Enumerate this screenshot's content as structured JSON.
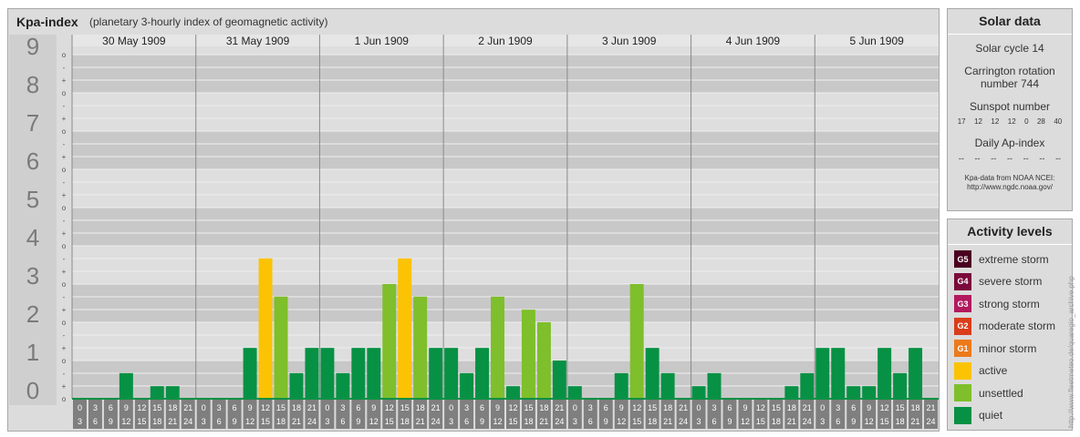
{
  "chart_data": {
    "type": "bar",
    "title": "Kpa-index",
    "subtitle": "(planetary 3-hourly index of geomagnetic activity)",
    "days": [
      "30 May 1909",
      "31 May 1909",
      "1 Jun 1909",
      "2 Jun 1909",
      "3 Jun 1909",
      "4 Jun 1909",
      "5 Jun 1909"
    ],
    "interval_labels": [
      [
        "0",
        "3"
      ],
      [
        "3",
        "6"
      ],
      [
        "6",
        "9"
      ],
      [
        "9",
        "12"
      ],
      [
        "12",
        "15"
      ],
      [
        "15",
        "18"
      ],
      [
        "18",
        "21"
      ],
      [
        "21",
        "24"
      ]
    ],
    "y_ticks": [
      "0",
      "1",
      "2",
      "3",
      "4",
      "5",
      "6",
      "7",
      "8",
      "9"
    ],
    "y_minor_ticks": [
      "o",
      "+",
      "-"
    ],
    "ylim": [
      0,
      9.33
    ],
    "values": [
      0,
      0,
      0,
      0.67,
      0,
      0.33,
      0.33,
      0,
      0,
      0,
      0,
      1.33,
      3.67,
      2.67,
      0.67,
      1.33,
      1.33,
      0.67,
      1.33,
      1.33,
      3.0,
      3.67,
      2.67,
      1.33,
      1.33,
      0.67,
      1.33,
      2.67,
      0.33,
      2.33,
      2.0,
      1.0,
      0.33,
      0,
      0,
      0.67,
      3.0,
      1.33,
      0.67,
      0,
      0.33,
      0.67,
      0,
      0,
      0,
      0,
      0.33,
      0.67,
      1.33,
      1.33,
      0.33,
      0.33,
      1.33,
      0.67,
      1.33,
      0
    ],
    "colors": {
      "quiet": "#079144",
      "unsettled": "#7ebf2b",
      "active": "#fbc304"
    }
  },
  "solar": {
    "title": "Solar data",
    "cycle": "Solar cycle 14",
    "carrington_line1": "Carrington rotation",
    "carrington_line2": "number 744",
    "sunspot_label": "Sunspot number",
    "sunspot_values": [
      "17",
      "12",
      "12",
      "12",
      "0",
      "28",
      "40"
    ],
    "ap_label": "Daily Ap-index",
    "ap_values": [
      "--",
      "--",
      "--",
      "--",
      "--",
      "--",
      "--"
    ],
    "credit_line1": "Kpa-data from NOAA NCEI:",
    "credit_line2": "http://www.ngdc.noaa.gov/"
  },
  "activity": {
    "title": "Activity levels",
    "levels": [
      {
        "badge": "G5",
        "label": "extreme storm",
        "color": "#4a0020"
      },
      {
        "badge": "G4",
        "label": "severe storm",
        "color": "#7a0a3a"
      },
      {
        "badge": "G3",
        "label": "strong storm",
        "color": "#b3195e"
      },
      {
        "badge": "G2",
        "label": "moderate storm",
        "color": "#d93d1a"
      },
      {
        "badge": "G1",
        "label": "minor storm",
        "color": "#ec7a1c"
      },
      {
        "badge": "",
        "label": "active",
        "color": "#fbc304"
      },
      {
        "badge": "",
        "label": "unsettled",
        "color": "#7ebf2b"
      },
      {
        "badge": "",
        "label": "quiet",
        "color": "#079144"
      }
    ]
  },
  "watermark": "http://www.fleetmeteo.de/quaregio_archive.php"
}
